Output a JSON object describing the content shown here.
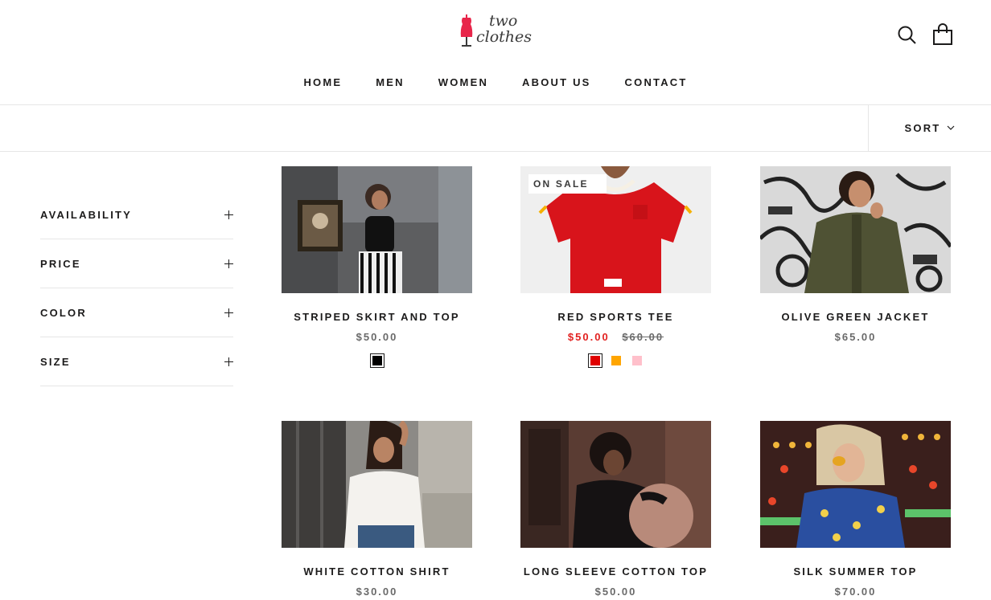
{
  "brand": {
    "line1": "two",
    "line2": "clothes"
  },
  "nav": [
    "HOME",
    "MEN",
    "WOMEN",
    "ABOUT US",
    "CONTACT"
  ],
  "sort_label": "SORT",
  "filters": [
    "AVAILABILITY",
    "PRICE",
    "COLOR",
    "SIZE"
  ],
  "colors": {
    "accent_sale": "#e22120",
    "logo_red": "#e8264a"
  },
  "products": [
    {
      "title": "STRIPED SKIRT AND TOP",
      "price": "$50.00",
      "swatches": [
        "#000000"
      ]
    },
    {
      "title": "RED SPORTS TEE",
      "badge": "ON SALE",
      "price": "$50.00",
      "compare_price": "$60.00",
      "swatches": [
        "#e00000",
        "#ffa500",
        "#ffc0cb"
      ]
    },
    {
      "title": "OLIVE GREEN JACKET",
      "price": "$65.00"
    },
    {
      "title": "WHITE COTTON SHIRT",
      "price": "$30.00"
    },
    {
      "title": "LONG SLEEVE COTTON TOP",
      "price": "$50.00"
    },
    {
      "title": "SILK SUMMER TOP",
      "price": "$70.00"
    }
  ]
}
